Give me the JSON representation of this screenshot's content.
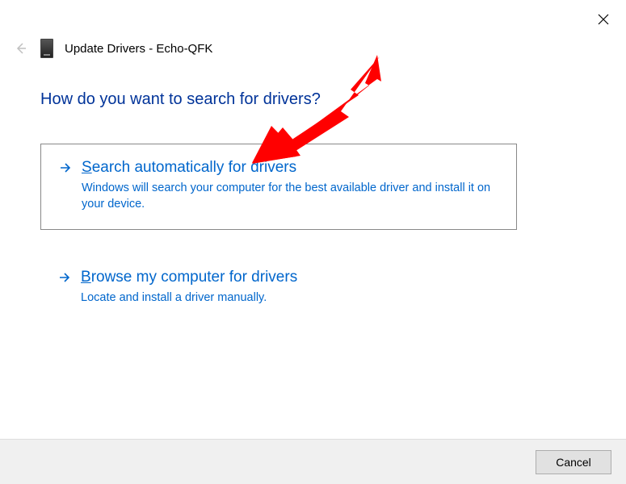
{
  "window": {
    "title_prefix": "Update Drivers - ",
    "device_name": "Echo-QFK"
  },
  "heading": "How do you want to search for drivers?",
  "options": [
    {
      "title_pre": "S",
      "title_rest": "earch automatically for drivers",
      "description": "Windows will search your computer for the best available driver and install it on your device."
    },
    {
      "title_pre": "B",
      "title_rest": "rowse my computer for drivers",
      "description": "Locate and install a driver manually."
    }
  ],
  "footer": {
    "cancel_label": "Cancel"
  },
  "colors": {
    "link_blue": "#0066cc",
    "heading_blue": "#003399",
    "callout_red": "#ff0000"
  }
}
